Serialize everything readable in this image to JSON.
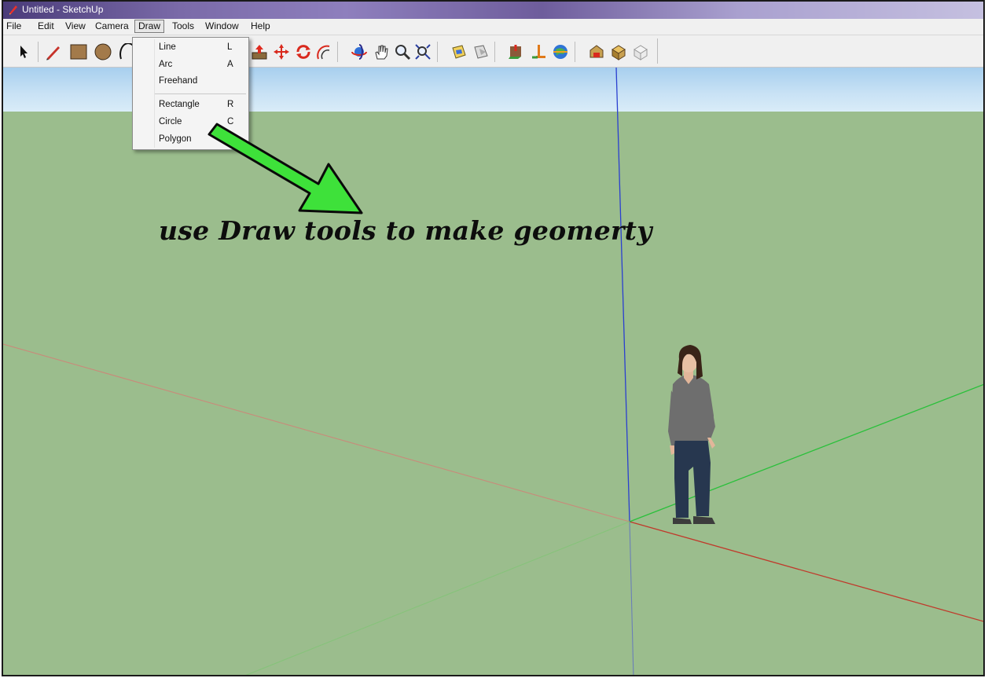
{
  "window": {
    "title": "Untitled - SketchUp"
  },
  "menu": {
    "items": [
      "File",
      "Edit",
      "View",
      "Camera",
      "Draw",
      "Tools",
      "Window",
      "Help"
    ],
    "active": "Draw"
  },
  "draw_menu": {
    "items": [
      {
        "label": "Line",
        "shortcut": "L"
      },
      {
        "label": "Arc",
        "shortcut": "A"
      },
      {
        "label": "Freehand",
        "shortcut": ""
      },
      {
        "label": "Rectangle",
        "shortcut": "R"
      },
      {
        "label": "Circle",
        "shortcut": "C"
      },
      {
        "label": "Polygon",
        "shortcut": ""
      }
    ]
  },
  "toolbar": {
    "tools": [
      "select-icon",
      "pencil-icon",
      "rectangle-icon",
      "circle-icon",
      "arc-icon",
      "push-pull-icon",
      "move-icon",
      "rotate-icon",
      "offset-icon",
      "orbit-icon",
      "pan-icon",
      "zoom-icon",
      "zoom-extents-icon",
      "get-models-icon",
      "share-model-icon",
      "geo-location-icon",
      "photo-textures-icon",
      "google-earth-icon",
      "extension-warehouse-icon",
      "share-component-icon",
      "components-icon"
    ]
  },
  "annotation": {
    "caption": "use Draw tools to make geomerty"
  },
  "colors": {
    "ground": "#9bbd8d",
    "sky": "#c9e2f5",
    "axis_blue": "#2a3fd0",
    "axis_red": "#c0392b",
    "axis_green": "#29c03a",
    "arrow": "#3ee13a"
  }
}
